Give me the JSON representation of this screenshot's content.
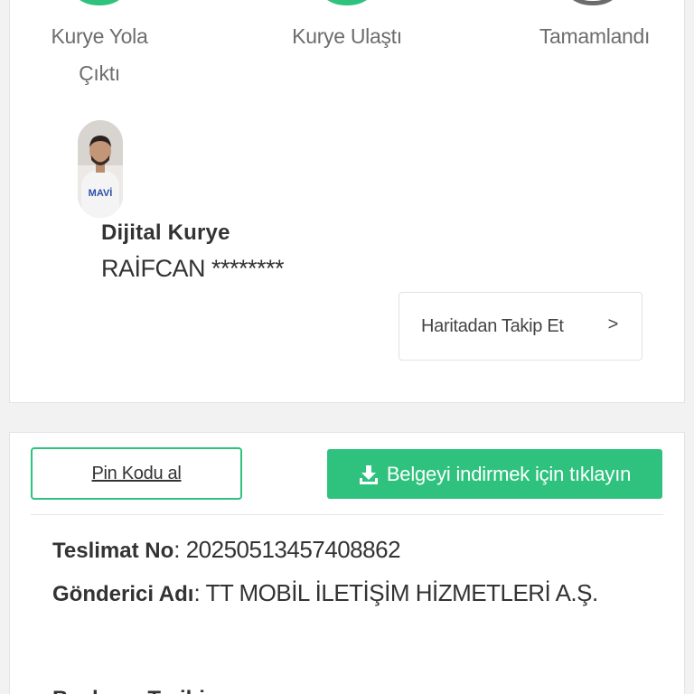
{
  "steps": [
    {
      "label": "Kurye Yola Çıktı",
      "status": "done",
      "color": "#2ec27e"
    },
    {
      "label": "Kurye Ulaştı",
      "status": "done",
      "color": "#2ec27e"
    },
    {
      "label": "Tamamlandı",
      "status": "pending",
      "color": "#6b6b6b"
    }
  ],
  "courier": {
    "role": "Dijital Kurye",
    "name": "RAİFCAN ********",
    "shirt_text": "MAVİ",
    "track_button_label": "Haritadan Takip Et",
    "track_button_chevron": ">"
  },
  "actions": {
    "pin_button_label": "Pin Kodu al",
    "download_button_label": "Belgeyi indirmek için tıklayın",
    "accent_color": "#2ec27e"
  },
  "details": {
    "delivery_no_label": "Teslimat No",
    "delivery_no_value": "20250513457408862",
    "sender_label": "Gönderici Adı",
    "sender_value": "TT MOBİL İLETİŞİM HİZMETLERİ A.Ş.",
    "next_label_partial": "Başlama Tarihi"
  }
}
